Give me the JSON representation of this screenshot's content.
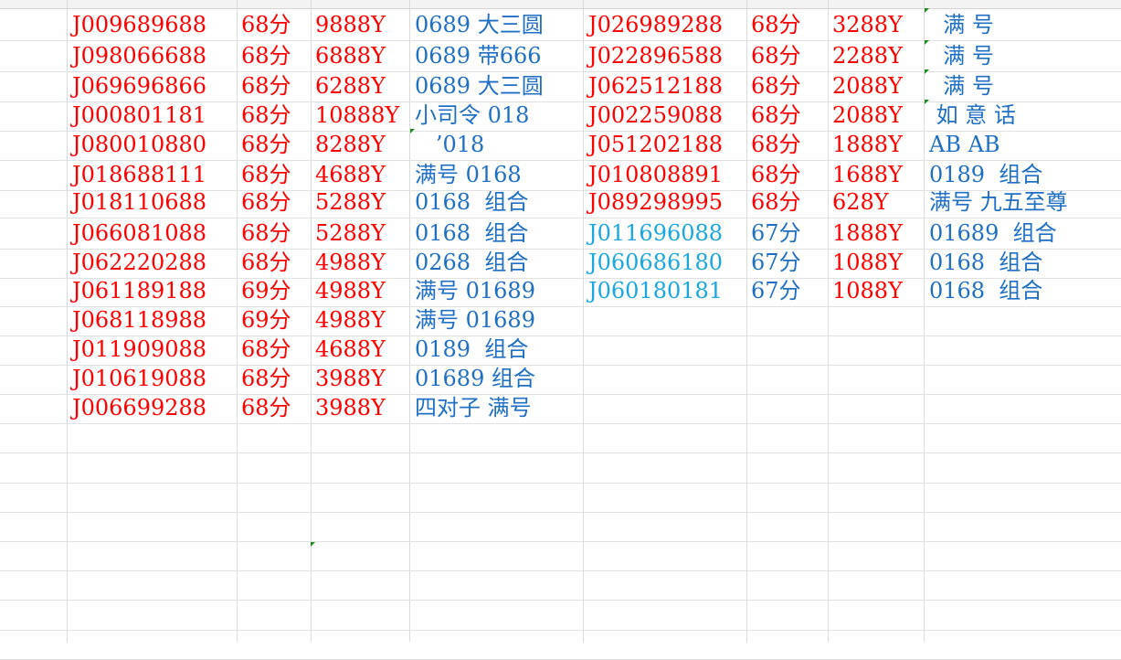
{
  "colors": {
    "codes": "#ff0000",
    "alt_codes": "#1aa6e0",
    "descriptions": "#1f6fc4",
    "grid": "#dadada"
  },
  "left_table": [
    {
      "code": "J009689688",
      "score": "68分",
      "price": "9888Y",
      "desc": "0689 大三圆"
    },
    {
      "code": "J098066688",
      "score": "68分",
      "price": "6888Y",
      "desc": "0689 带666"
    },
    {
      "code": "J069696866",
      "score": "68分",
      "price": "6288Y",
      "desc": "0689 大三圆"
    },
    {
      "code": "J000801181",
      "score": "68分",
      "price": "10888Y",
      "desc": "小司令 018"
    },
    {
      "code": "J080010880",
      "score": "68分",
      "price": "8288Y",
      "desc": "   ’018"
    },
    {
      "code": "J018688111",
      "score": "68分",
      "price": "4688Y",
      "desc": "满号 0168"
    },
    {
      "code": "J018110688",
      "score": "68分",
      "price": "5288Y",
      "desc": "0168  组合"
    },
    {
      "code": "J066081088",
      "score": "68分",
      "price": "5288Y",
      "desc": "0168  组合"
    },
    {
      "code": "J062220288",
      "score": "68分",
      "price": "4988Y",
      "desc": "0268  组合"
    },
    {
      "code": "J061189188",
      "score": "69分",
      "price": "4988Y",
      "desc": "满号 01689"
    },
    {
      "code": "J068118988",
      "score": "69分",
      "price": "4988Y",
      "desc": "满号 01689"
    },
    {
      "code": "J011909088",
      "score": "68分",
      "price": "4688Y",
      "desc": "0189  组合"
    },
    {
      "code": "J010619088",
      "score": "68分",
      "price": "3988Y",
      "desc": "01689 组合"
    },
    {
      "code": "J006699288",
      "score": "68分",
      "price": "3988Y",
      "desc": "四对子 满号"
    }
  ],
  "right_table": [
    {
      "code": "J026989288",
      "score": "68分",
      "price": "3288Y",
      "desc": "  满 号"
    },
    {
      "code": "J022896588",
      "score": "68分",
      "price": "2288Y",
      "desc": "  满 号"
    },
    {
      "code": "J062512188",
      "score": "68分",
      "price": "2088Y",
      "desc": "  满 号"
    },
    {
      "code": "J002259088",
      "score": "68分",
      "price": "2088Y",
      "desc": " 如 意 话"
    },
    {
      "code": "J051202188",
      "score": "68分",
      "price": "1888Y",
      "desc": "AB AB"
    },
    {
      "code": "J010808891",
      "score": "68分",
      "price": "1688Y",
      "desc": "0189  组合"
    },
    {
      "code": "J089298995",
      "score": "68分",
      "price": "628Y",
      "desc": "满号 九五至尊"
    },
    {
      "code": "J011696088",
      "score": "67分",
      "price": "1888Y",
      "desc": "01689  组合"
    },
    {
      "code": "J060686180",
      "score": "67分",
      "price": "1088Y",
      "desc": "0168  组合"
    },
    {
      "code": "J060180181",
      "score": "67分",
      "price": "1088Y",
      "desc": "0168  组合"
    }
  ]
}
